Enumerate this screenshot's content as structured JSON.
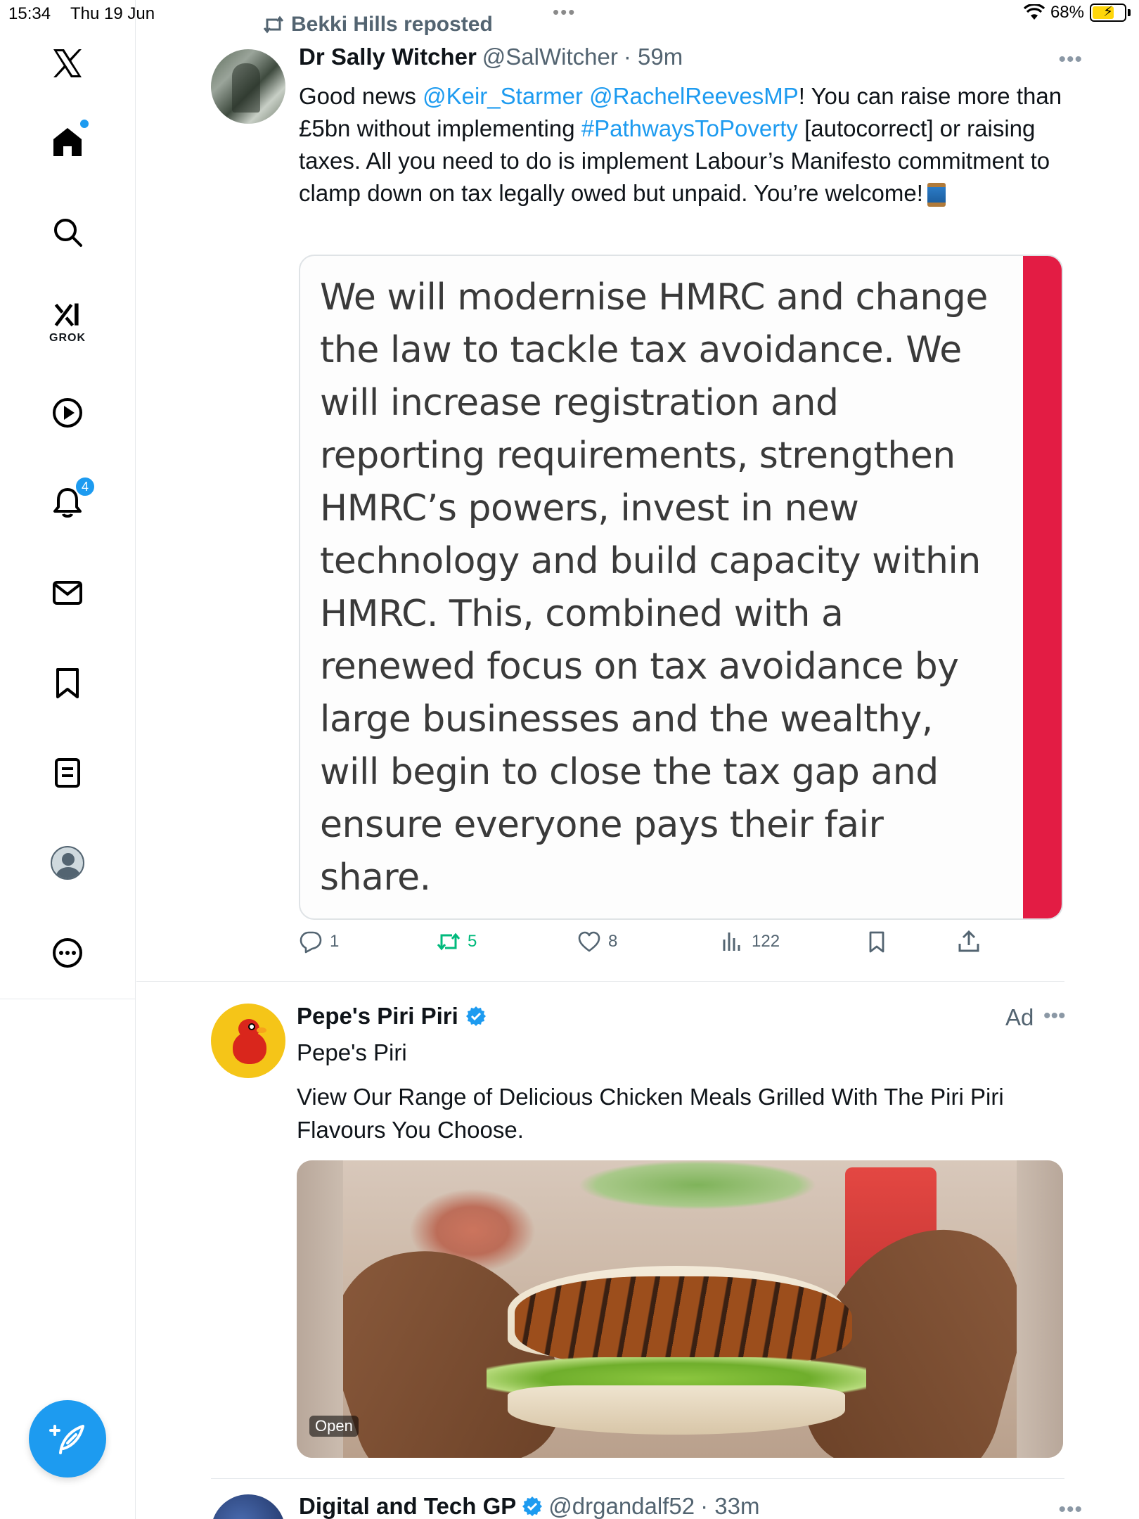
{
  "status_bar": {
    "time": "15:34",
    "date": "Thu 19 Jun",
    "battery": "68%",
    "battery_level": 0.68
  },
  "sidebar": {
    "notifications_count": "4",
    "grok_label": "GROK",
    "items": [
      {
        "icon": "x-logo-icon"
      },
      {
        "icon": "home-icon"
      },
      {
        "icon": "search-icon"
      },
      {
        "icon": "grok-icon"
      },
      {
        "icon": "video-icon"
      },
      {
        "icon": "bell-icon"
      },
      {
        "icon": "mail-icon"
      },
      {
        "icon": "bookmark-icon"
      },
      {
        "icon": "lists-icon"
      },
      {
        "icon": "profile-icon"
      },
      {
        "icon": "more-icon"
      }
    ],
    "compose_icon": "compose-icon"
  },
  "feed": {
    "post1": {
      "repost_text": "Bekki Hills reposted",
      "name": "Dr Sally Witcher",
      "handle": "@SalWitcher",
      "time": "· 59m",
      "text": {
        "p1": "Good news ",
        "mention1": "@Keir_Starmer",
        "p2": "  ",
        "mention2": "@RachelReevesMP",
        "p3": "! You can raise more than £5bn without implementing ",
        "hashtag": "#PathwaysToPoverty",
        "p4": " [autocorrect] or raising taxes. All you need to do is implement Labour’s Manifesto commitment to clamp down on tax legally owed but unpaid. You’re welcome!"
      },
      "quote_image_text": "We will modernise HMRC and change the law to tackle tax avoidance. We will increase registration and reporting requirements, strengthen HMRC’s powers, invest in new technology and build capacity within HMRC. This, combined with a renewed focus on tax avoidance by large businesses and the wealthy, will begin to close the tax gap and ensure everyone pays their fair share.",
      "actions": {
        "replies": "1",
        "reposts": "5",
        "likes": "8",
        "views": "122"
      }
    },
    "ad": {
      "name": "Pepe's Piri Piri",
      "subtitle": "Pepe's Piri",
      "label": "Ad",
      "text": "View Our Range of Delicious Chicken Meals Grilled With The Piri Piri Flavours You Choose.",
      "image_badge": "Open"
    },
    "post3": {
      "name": "Digital and Tech GP",
      "handle": "@drgandalf52",
      "time": "· 33m"
    }
  },
  "colors": {
    "accent": "#1d9bf0",
    "repost_green": "#00ba7c",
    "quote_bar": "#e31c44"
  }
}
